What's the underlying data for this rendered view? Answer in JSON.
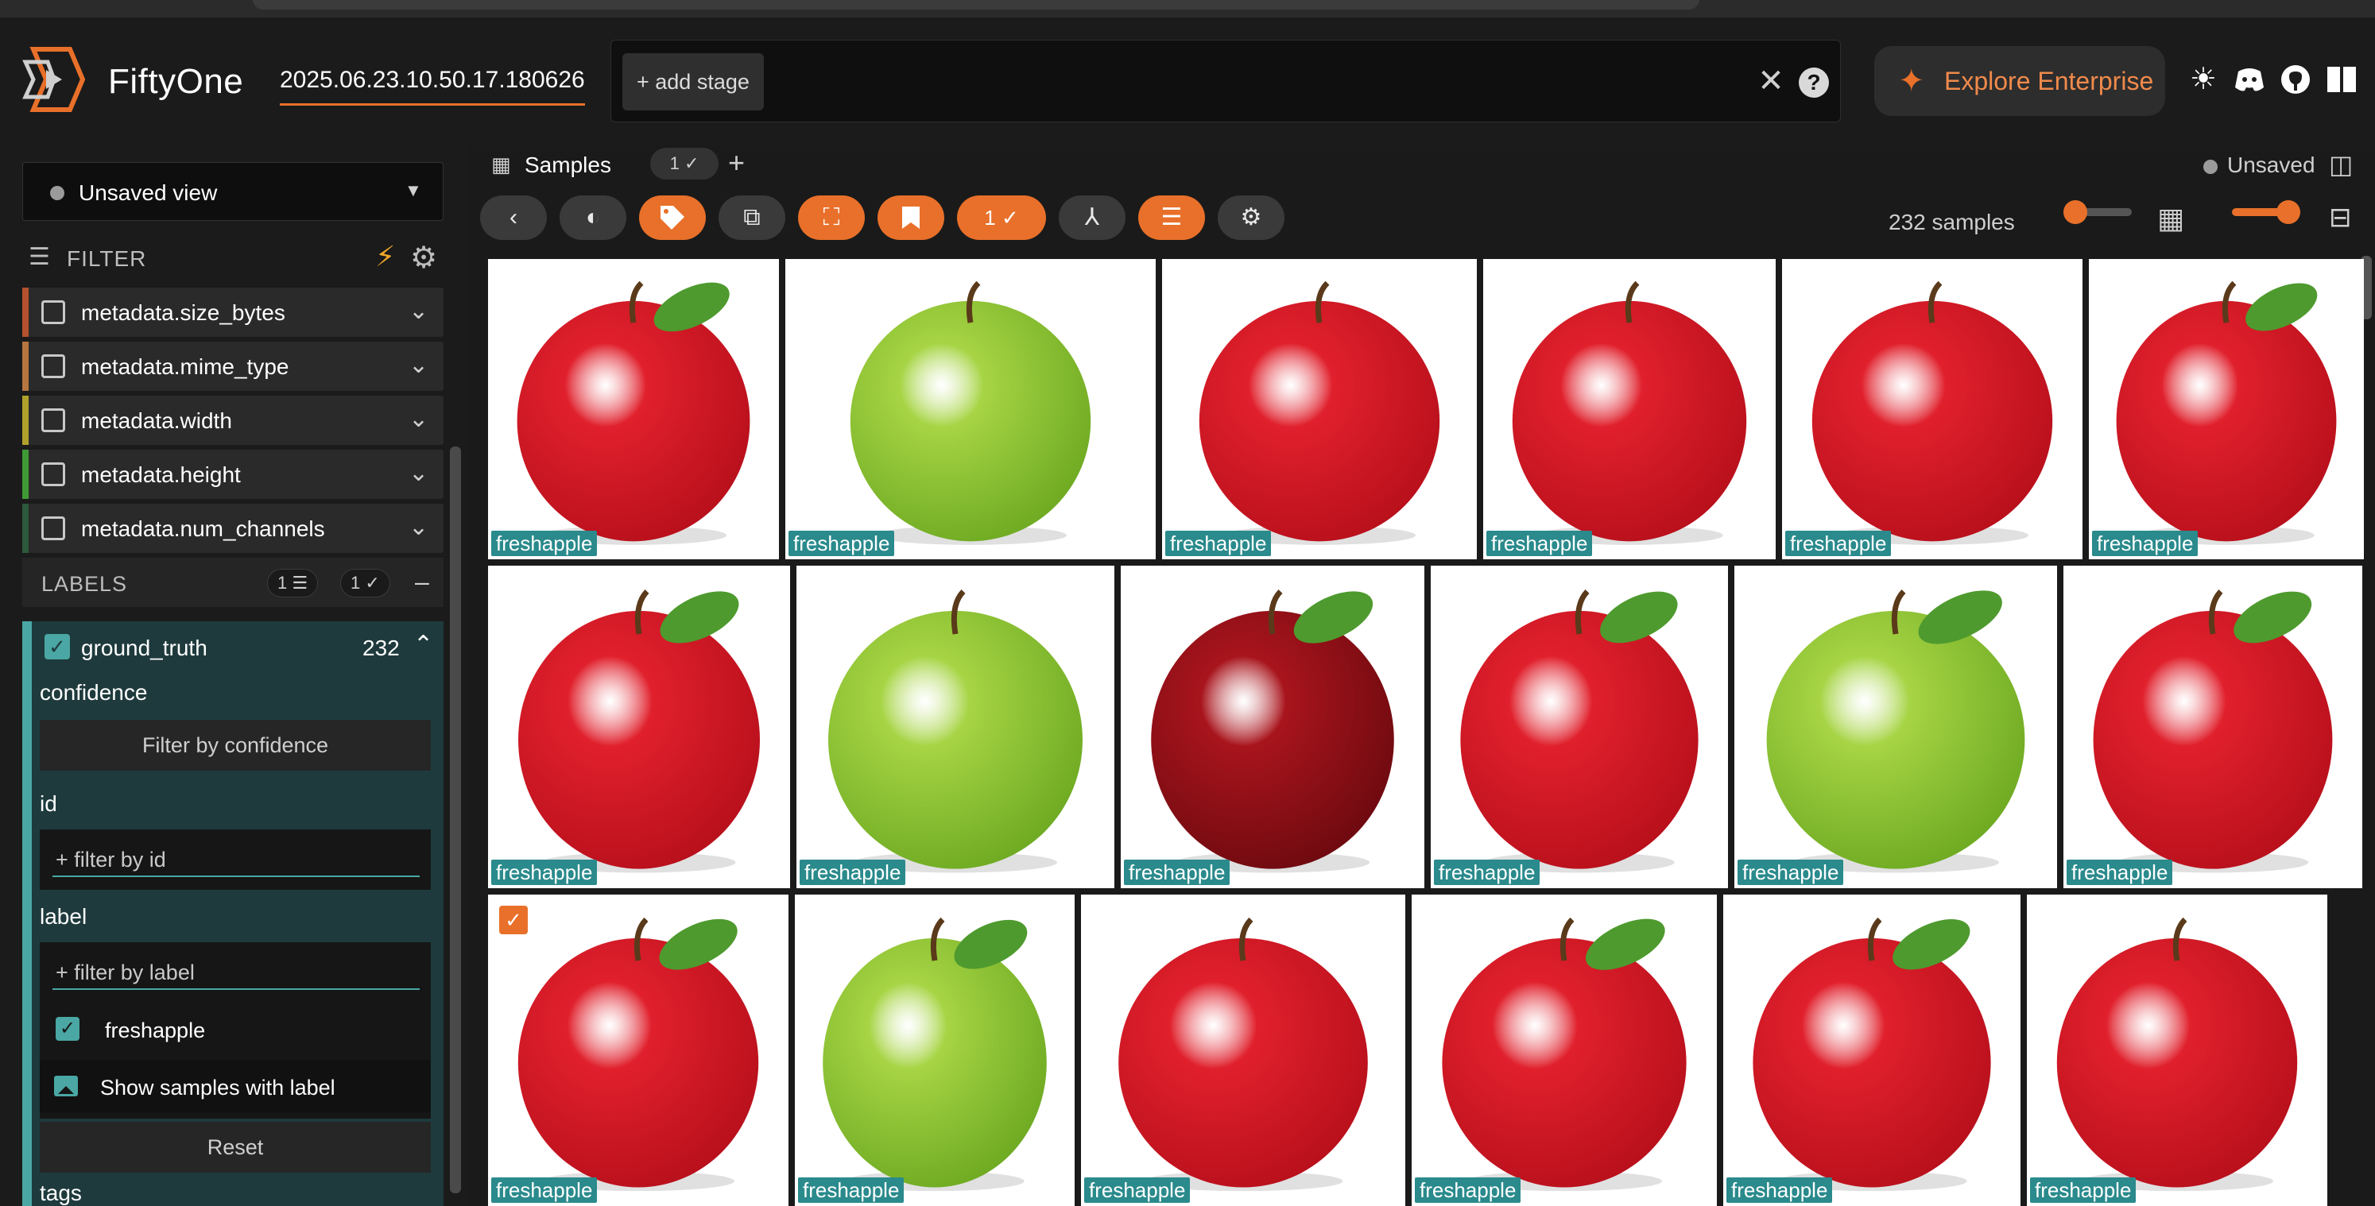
{
  "app": {
    "brand": "FiftyOne",
    "dataset_name": "2025.06.23.10.50.17.180626",
    "add_stage_label": "+ add stage",
    "enterprise_label": "Explore Enterprise"
  },
  "sidebar": {
    "view_select": "Unsaved view",
    "filter_title": "FILTER",
    "fields": [
      {
        "label": "metadata.size_bytes",
        "color": "#b5512f"
      },
      {
        "label": "metadata.mime_type",
        "color": "#b5763f"
      },
      {
        "label": "metadata.width",
        "color": "#b0a12c"
      },
      {
        "label": "metadata.height",
        "color": "#3f9a35"
      },
      {
        "label": "metadata.num_channels",
        "color": "#2c5a3a"
      }
    ],
    "labels_title": "LABELS",
    "labels_chip_filter": "1",
    "labels_chip_check": "1",
    "ground_truth": {
      "name": "ground_truth",
      "count": "232",
      "confidence_label": "confidence",
      "confidence_button": "Filter by confidence",
      "id_label": "id",
      "id_placeholder": "+ filter by id",
      "label_label": "label",
      "label_placeholder": "+ filter by label",
      "label_value": "freshapple",
      "show_samples": "Show samples with label",
      "reset": "Reset",
      "tags_label": "tags"
    }
  },
  "main": {
    "tab_label": "Samples",
    "tab_chip": "1 ✓",
    "unsaved_label": "Unsaved",
    "selected_chip": "1",
    "sample_count": "232 samples",
    "thumbnail_label": "freshapple"
  },
  "colors": {
    "accent": "#e8702a",
    "teal": "#4aa7a4",
    "tag": "#2a8a8c"
  },
  "gallery": [
    {
      "apple": "red",
      "leaf": true
    },
    {
      "apple": "green",
      "leaf": false
    },
    {
      "apple": "red",
      "leaf": false
    },
    {
      "apple": "red",
      "leaf": false
    },
    {
      "apple": "red",
      "leaf": false
    },
    {
      "apple": "red",
      "leaf": true
    },
    {
      "apple": "red",
      "leaf": true
    },
    {
      "apple": "green",
      "leaf": false
    },
    {
      "apple": "darkred",
      "leaf": true
    },
    {
      "apple": "red",
      "leaf": true
    },
    {
      "apple": "green",
      "leaf": true
    },
    {
      "apple": "red",
      "leaf": true
    },
    {
      "apple": "red",
      "leaf": true,
      "selected": true
    },
    {
      "apple": "green",
      "leaf": true
    },
    {
      "apple": "red",
      "leaf": false
    },
    {
      "apple": "red",
      "leaf": true
    },
    {
      "apple": "red",
      "leaf": true
    },
    {
      "apple": "red",
      "leaf": false
    }
  ]
}
